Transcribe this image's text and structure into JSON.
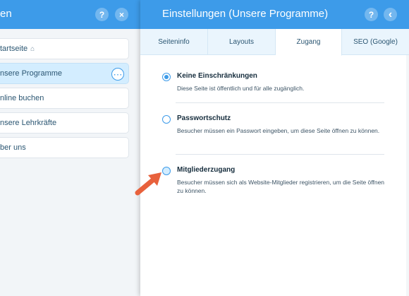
{
  "left_panel": {
    "title": "en",
    "help_icon": "?",
    "close_icon": "×",
    "pages": [
      {
        "label": "tartseite",
        "home_icon": "⌂"
      },
      {
        "label": "nsere Programme",
        "more_icon": "⋯"
      },
      {
        "label": "nline buchen"
      },
      {
        "label": "nsere Lehrkräfte"
      },
      {
        "label": "ber uns"
      }
    ]
  },
  "settings_panel": {
    "title": "Einstellungen (Unsere Programme)",
    "help_icon": "?",
    "back_icon": "‹",
    "tabs": [
      "Seiteninfo",
      "Layouts",
      "Zugang",
      "SEO (Google)"
    ],
    "active_tab": "Zugang",
    "options": [
      {
        "title": "Keine Einschränkungen",
        "description": "Diese Seite ist öffentlich und für alle zugänglich.",
        "checked": true
      },
      {
        "title": "Passwortschutz",
        "description": "Besucher müssen ein Passwort eingeben, um diese Seite öffnen zu können.",
        "checked": false
      },
      {
        "title": "Mitgliederzugang",
        "description": "Besucher müssen sich als Website-Mitglieder registrieren, um die Seite öffnen zu können.",
        "checked": false
      }
    ]
  },
  "colors": {
    "accent": "#3d9be9",
    "selected_bg": "#d3edff",
    "arrow": "#e8613c",
    "text_dark": "#162d3d"
  }
}
